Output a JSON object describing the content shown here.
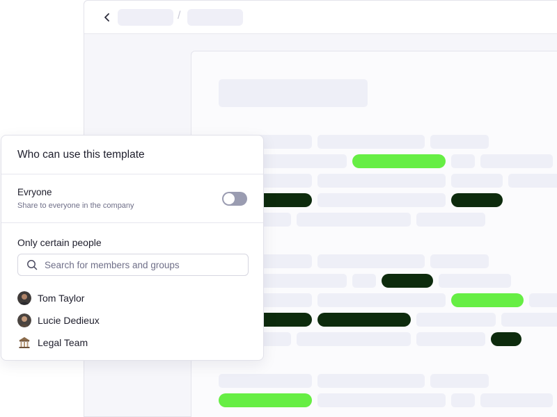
{
  "panel": {
    "title": "Who can use this template",
    "everyone": {
      "label": "Evryone",
      "description": "Share to everyone in the company",
      "enabled": false
    },
    "certain_people": {
      "label": "Only certain people",
      "search": {
        "placeholder": "Search for members and groups",
        "value": ""
      },
      "members": [
        {
          "name": "Tom Taylor",
          "icon": "avatar-photo"
        },
        {
          "name": "Lucie Dedieux",
          "icon": "avatar-photo"
        },
        {
          "name": "Legal Team",
          "icon": "bank-building-icon"
        }
      ]
    }
  },
  "background": {
    "breadcrumb_separator": "/",
    "highlight_colors": {
      "green": "#66ee44",
      "dark": "#0d2b0d"
    }
  }
}
